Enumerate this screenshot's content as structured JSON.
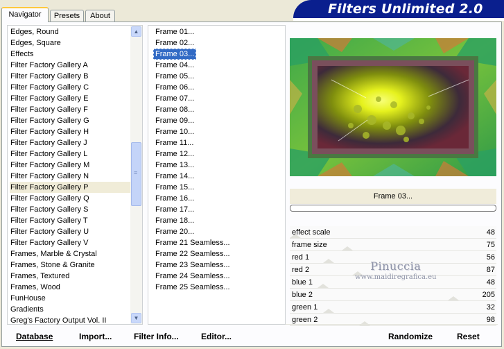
{
  "header": {
    "title": "Filters Unlimited 2.0",
    "tabs": [
      {
        "label": "Navigator",
        "active": true
      },
      {
        "label": "Presets",
        "active": false
      },
      {
        "label": "About",
        "active": false
      }
    ]
  },
  "categories": {
    "items": [
      "Edges, Round",
      "Edges, Square",
      "Effects",
      "Filter Factory Gallery A",
      "Filter Factory Gallery B",
      "Filter Factory Gallery C",
      "Filter Factory Gallery E",
      "Filter Factory Gallery F",
      "Filter Factory Gallery G",
      "Filter Factory Gallery H",
      "Filter Factory Gallery J",
      "Filter Factory Gallery L",
      "Filter Factory Gallery M",
      "Filter Factory Gallery N",
      "Filter Factory Gallery P",
      "Filter Factory Gallery Q",
      "Filter Factory Gallery S",
      "Filter Factory Gallery T",
      "Filter Factory Gallery U",
      "Filter Factory Gallery V",
      "Frames, Marble & Crystal",
      "Frames, Stone & Granite",
      "Frames, Textured",
      "Frames, Wood",
      "FunHouse",
      "Gradients",
      "Greg's Factory Output Vol. II"
    ],
    "selected": "Filter Factory Gallery P"
  },
  "filters": {
    "items": [
      "Frame 01...",
      "Frame 02...",
      "Frame 03...",
      "Frame 04...",
      "Frame 05...",
      "Frame 06...",
      "Frame 07...",
      "Frame 08...",
      "Frame 09...",
      "Frame 10...",
      "Frame 11...",
      "Frame 12...",
      "Frame 13...",
      "Frame 14...",
      "Frame 15...",
      "Frame 16...",
      "Frame 17...",
      "Frame 18...",
      "Frame 20...",
      "Frame 21 Seamless...",
      "Frame 22 Seamless...",
      "Frame 23 Seamless...",
      "Frame 24 Seamless...",
      "Frame 25 Seamless..."
    ],
    "selected": "Frame 03..."
  },
  "preview": {
    "caption": "Frame 03...",
    "progress": 0
  },
  "params": [
    {
      "name": "effect scale",
      "value": "48"
    },
    {
      "name": "frame size",
      "value": "75"
    },
    {
      "name": "red 1",
      "value": "56"
    },
    {
      "name": "red 2",
      "value": "87"
    },
    {
      "name": "blue 1",
      "value": "48"
    },
    {
      "name": "blue 2",
      "value": "205"
    },
    {
      "name": "green 1",
      "value": "32"
    },
    {
      "name": "green 2",
      "value": "98"
    }
  ],
  "watermark": {
    "line1": "Pinuccia",
    "line2": "www.maidiregrafica.eu"
  },
  "buttons": {
    "database": "Database",
    "import": "Import...",
    "filter_info": "Filter Info...",
    "editor": "Editor...",
    "randomize": "Randomize",
    "reset": "Reset"
  },
  "colors": {
    "accent_blue": "#0a1f8e",
    "selection": "#316ac5",
    "tab_highlight": "#ffc83c"
  }
}
